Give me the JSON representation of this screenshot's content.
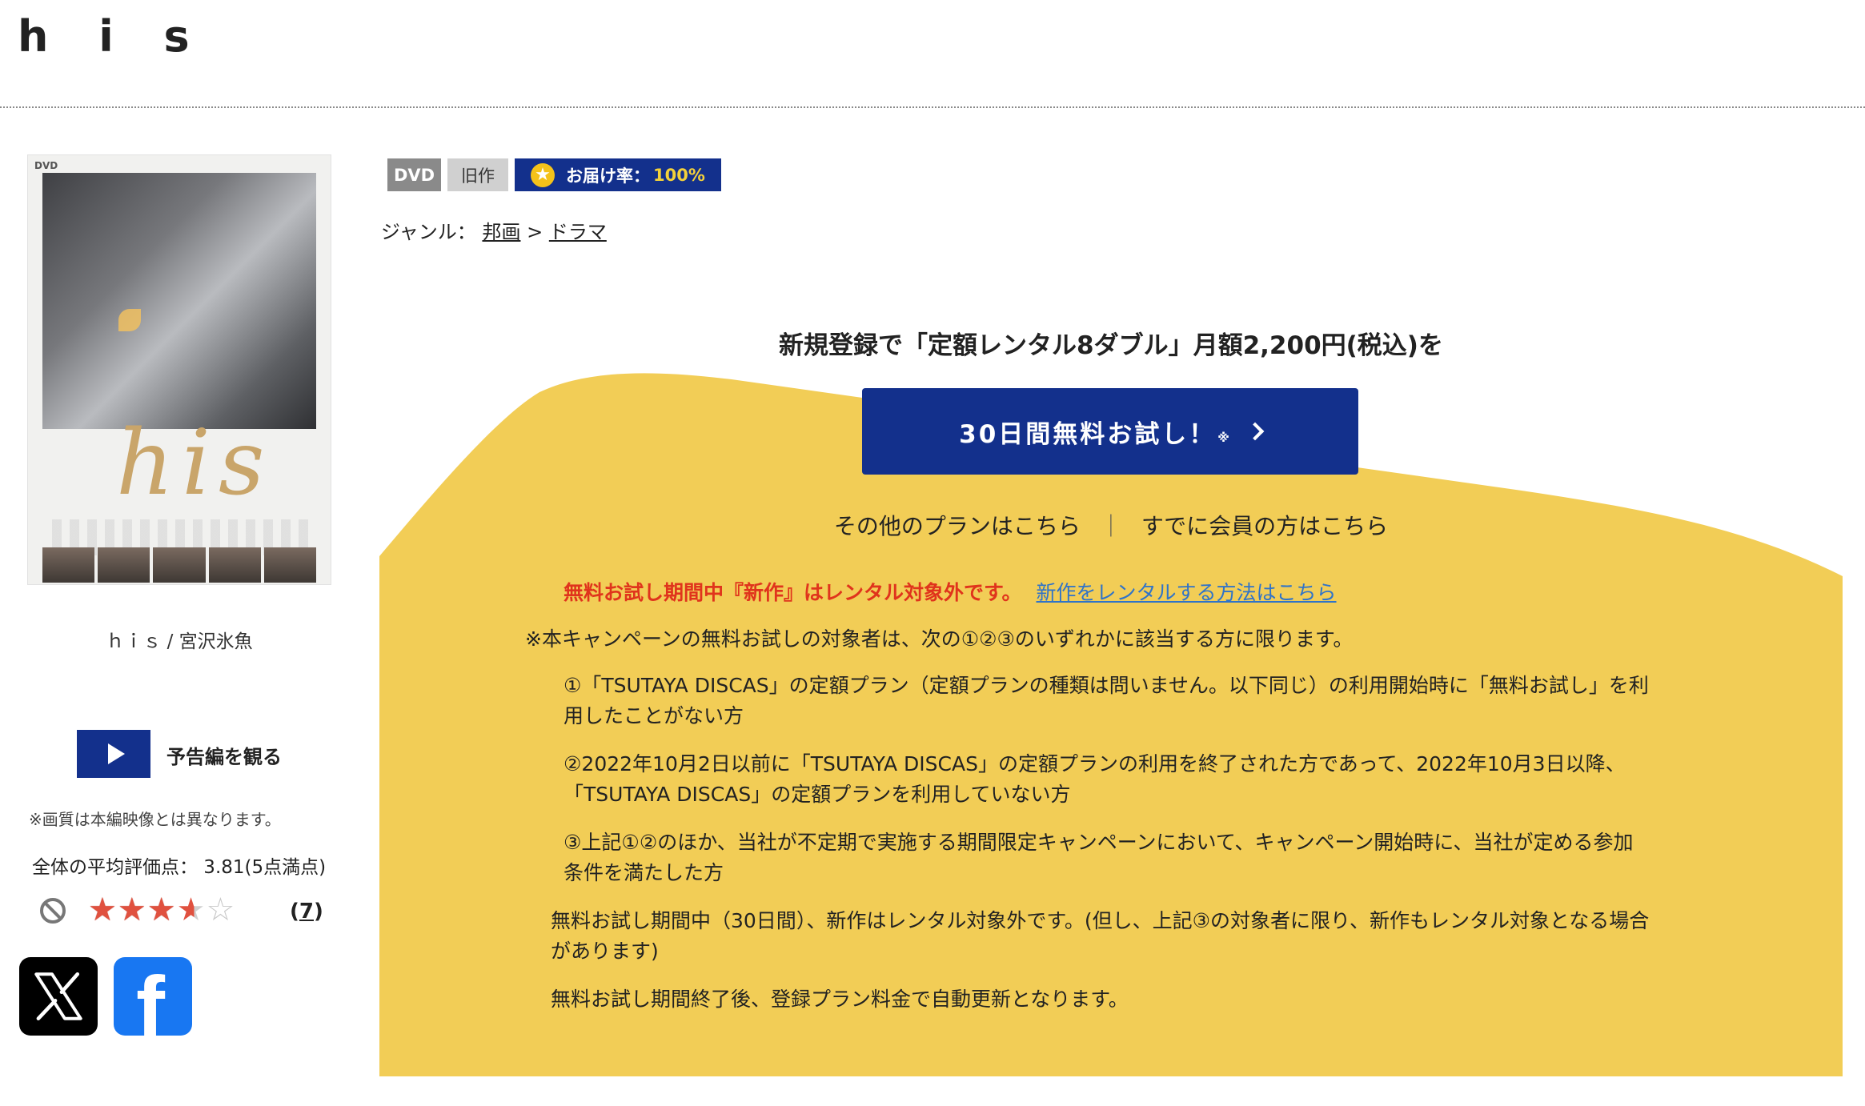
{
  "page": {
    "title": "h i s"
  },
  "jacket": {
    "dvd_mark": "DVD"
  },
  "work": {
    "caption": "ｈｉｓ / 宮沢氷魚"
  },
  "trailer": {
    "label": "予告編を観る"
  },
  "quality_note": "※画質は本編映像とは異なります。",
  "rating": {
    "average_text": "全体の平均評価点： 3.81(5点満点)",
    "average_value": 3.81,
    "max": 5,
    "stars": [
      "★",
      "★",
      "★",
      "★",
      "☆"
    ],
    "review_count_open": "(",
    "review_count": "7",
    "review_count_close": ")"
  },
  "sns": {
    "x_icon": "x-logo-icon",
    "facebook_glyph": "f"
  },
  "badges": {
    "dvd": "DVD",
    "old": "旧作",
    "delivery_star": "★",
    "delivery_label": "お届け率：",
    "delivery_rate": "100%"
  },
  "genre": {
    "label": "ジャンル：",
    "level1": "邦画",
    "separator": " > ",
    "level2": "ドラマ"
  },
  "campaign": {
    "headline": "新規登録で「定額レンタル8ダブル」月額2,200円(税込)を",
    "cta_label": "30日間無料お試し！",
    "cta_note": "※",
    "other_plans": "その他のプランはこちら",
    "link_separator": "｜",
    "member_link": "すでに会員の方はこちら",
    "colors": {
      "yellow": "#f2cd56",
      "navy": "#13308c",
      "warn_red": "#e0341c",
      "link_blue": "#2f73c9"
    }
  },
  "notes": {
    "warning": "無料お試し期間中『新作』はレンタル対象外です。",
    "warning_link": "新作をレンタルする方法はこちら",
    "eligibility": "※本キャンペーンの無料お試しの対象者は、次の①②③のいずれかに該当する方に限ります。",
    "item1_line1": "①「TSUTAYA DISCAS」の定額プラン（定額プランの種類は問いません。以下同じ）の利用開始時に「無料お試し」を利",
    "item1_line2": "用したことがない方",
    "item2_line1": "②2022年10月2日以前に「TSUTAYA DISCAS」の定額プランの利用を終了された方であって、2022年10月3日以降、",
    "item2_line2": "「TSUTAYA DISCAS」の定額プランを利用していない方",
    "item3_line1": "③上記①②のほか、当社が不定期で実施する期間限定キャンペーンにおいて、キャンペーン開始時に、当社が定める参加",
    "item3_line2": "条件を満たした方",
    "trial_line1": "無料お試し期間中（30日間）、新作はレンタル対象外です。(但し、上記③の対象者に限り、新作もレンタル対象となる場合",
    "trial_line2": "があります)",
    "renewal": "無料お試し期間終了後、登録プラン料金で自動更新となります。"
  }
}
